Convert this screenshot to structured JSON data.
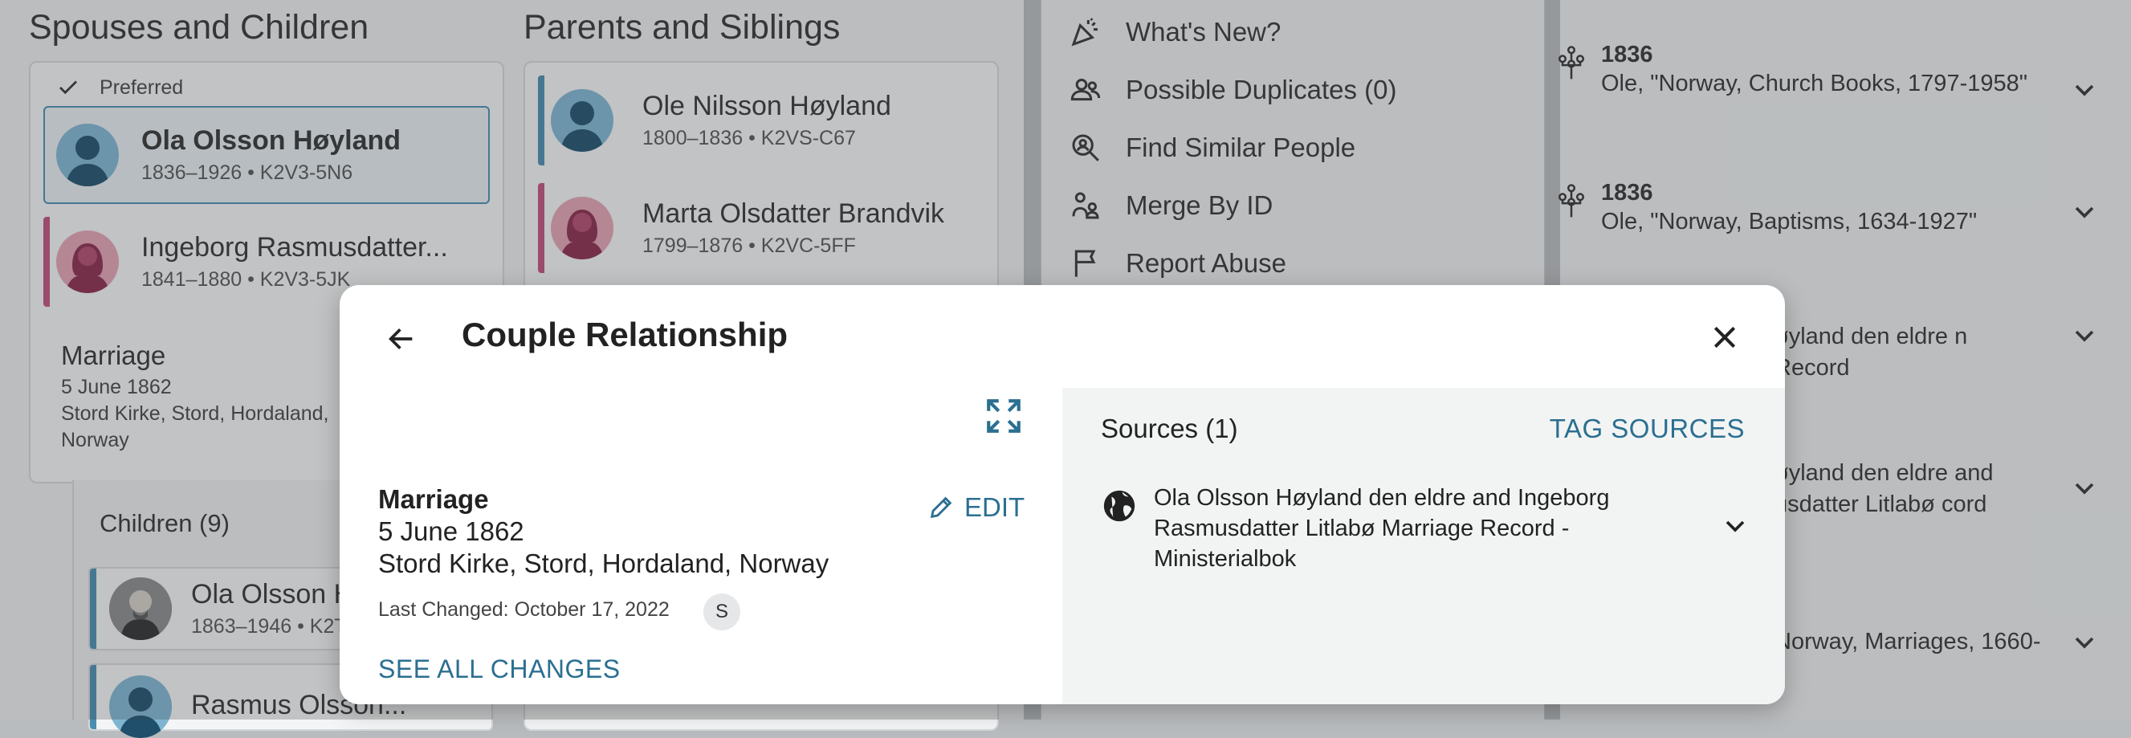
{
  "background": {
    "spouses": {
      "title": "Spouses and Children",
      "preferred_label": "Preferred",
      "spouse1": {
        "name": "Ola Olsson Høyland",
        "meta": "1836–1926 • K2V3-5N6"
      },
      "spouse2": {
        "name": "Ingeborg Rasmusdatter...",
        "meta": "1841–1880 • K2V3-5JK"
      },
      "marriage": {
        "type": "Marriage",
        "date": "5 June 1862",
        "place_line1": "Stord Kirke, Stord, Hordaland,",
        "place_line2": "Norway"
      },
      "children_title": "Children (9)",
      "child1": {
        "name": "Ola Olsson H",
        "meta": "1863–1946 • K2T"
      },
      "child2": {
        "name": "Rasmus Olsson..."
      }
    },
    "parents": {
      "title": "Parents and Siblings",
      "father": {
        "name": "Ole Nilsson Høyland",
        "meta": "1800–1836 • K2VS-C67"
      },
      "mother": {
        "name": "Marta Olsdatter Brandvik",
        "meta": "1799–1876 • K2VC-5FF"
      }
    },
    "tools": {
      "whats_new": "What's New?",
      "possible_duplicates": "Possible Duplicates (0)",
      "find_similar": "Find Similar People",
      "merge_by_id": "Merge By ID",
      "report_abuse": "Report Abuse"
    },
    "records": [
      {
        "year": "1836",
        "text": "Ole, \"Norway, Church Books, 1797-1958\""
      },
      {
        "year": "1836",
        "text": "Ole, \"Norway, Baptisms, 1634-1927\""
      },
      {
        "text": "øyland den eldre n Record"
      },
      {
        "text": "øyland den eldre and usdatter Litlabø cord"
      },
      {
        "text": "Norway, Marriages, 1660-"
      }
    ]
  },
  "modal": {
    "title": "Couple Relationship",
    "event": {
      "type": "Marriage",
      "date": "5 June 1862",
      "place": "Stord Kirke, Stord, Hordaland, Norway"
    },
    "edit_label": "EDIT",
    "last_changed": "Last Changed: October 17, 2022",
    "contributor_initial": "S",
    "see_all_changes": "SEE ALL CHANGES",
    "sources_title": "Sources (1)",
    "tag_sources": "TAG SOURCES",
    "source_text": "Ola Olsson Høyland den eldre and Ingeborg Rasmusdatter Litlabø Marriage Record - Ministerialbok"
  },
  "colors": {
    "link": "#2b6f91",
    "male_bar": "#4a8db0",
    "female_bar": "#c04f7d"
  },
  "icons": [
    "party-popper-icon",
    "people-icon",
    "person-search-icon",
    "merge-icon",
    "flag-icon",
    "family-tree-icon",
    "chevron-down-icon",
    "back-arrow-icon",
    "close-icon",
    "expand-icon",
    "pencil-icon",
    "globe-icon",
    "checkmark-icon"
  ]
}
